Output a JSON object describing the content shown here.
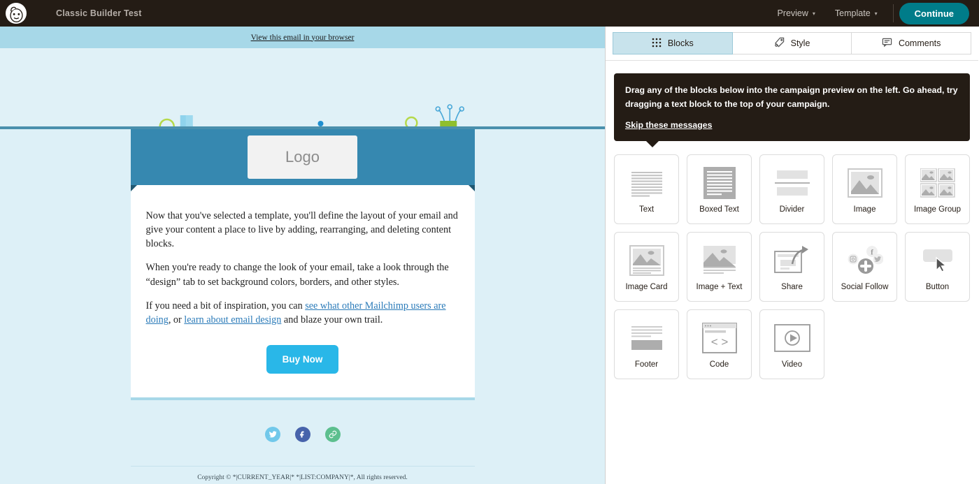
{
  "topbar": {
    "logo_icon": "mailchimp-freddie-icon",
    "title": "Classic Builder Test",
    "preview_label": "Preview",
    "template_label": "Template",
    "continue_label": "Continue",
    "caret_glyph": "▾",
    "accent_color": "#007c89",
    "background_color": "#241c15"
  },
  "preview": {
    "browser_link": "View this email in your browser",
    "hero_alt": "celebration-confetti-illustration",
    "logo_placeholder": "Logo",
    "logo_band_color": "#3688b0",
    "paragraphs": [
      {
        "segments": [
          {
            "text": "Now that you've selected a template, you'll define the layout of your email and give your content a place to live by adding, rearranging, and deleting content blocks.",
            "link": false
          }
        ]
      },
      {
        "segments": [
          {
            "text": "When you're ready to change the look of your email, take a look through the “design” tab to set background colors, borders, and other styles.",
            "link": false
          }
        ]
      },
      {
        "segments": [
          {
            "text": "If you need a bit of inspiration, you can ",
            "link": false
          },
          {
            "text": "see what other Mailchimp users are doing",
            "link": true
          },
          {
            "text": ", or ",
            "link": false
          },
          {
            "text": "learn about email design",
            "link": true
          },
          {
            "text": " and blaze your own trail.",
            "link": false
          }
        ]
      }
    ],
    "buy_button_label": "Buy Now",
    "buy_button_color": "#29b7e8",
    "social": [
      {
        "name": "twitter",
        "color": "#71c8ea"
      },
      {
        "name": "facebook",
        "color": "#4763ab"
      },
      {
        "name": "link",
        "color": "#5cbf8e"
      }
    ],
    "footer_copyright": "Copyright © *|CURRENT_YEAR|* *|LIST:COMPANY|*, All rights reserved."
  },
  "panel": {
    "tabs": [
      {
        "label": "Blocks",
        "icon": "grid-dots-icon",
        "active": true
      },
      {
        "label": "Style",
        "icon": "paint-tag-icon",
        "active": false
      },
      {
        "label": "Comments",
        "icon": "comment-bubble-icon",
        "active": false
      }
    ],
    "tooltip": {
      "message": "Drag any of the blocks below into the campaign preview on the left. Go ahead, try dragging a text block to the top of your campaign.",
      "skip_label": "Skip these messages"
    },
    "blocks": [
      {
        "label": "Text",
        "icon": "text-lines-icon"
      },
      {
        "label": "Boxed Text",
        "icon": "boxed-text-icon"
      },
      {
        "label": "Divider",
        "icon": "divider-icon"
      },
      {
        "label": "Image",
        "icon": "image-icon"
      },
      {
        "label": "Image Group",
        "icon": "image-group-icon"
      },
      {
        "label": "Image Card",
        "icon": "image-card-icon"
      },
      {
        "label": "Image + Text",
        "icon": "image-text-icon"
      },
      {
        "label": "Share",
        "icon": "share-arrow-icon"
      },
      {
        "label": "Social Follow",
        "icon": "social-follow-icon"
      },
      {
        "label": "Button",
        "icon": "button-cursor-icon"
      },
      {
        "label": "Footer",
        "icon": "footer-icon"
      },
      {
        "label": "Code",
        "icon": "code-window-icon"
      },
      {
        "label": "Video",
        "icon": "video-play-icon"
      }
    ]
  }
}
